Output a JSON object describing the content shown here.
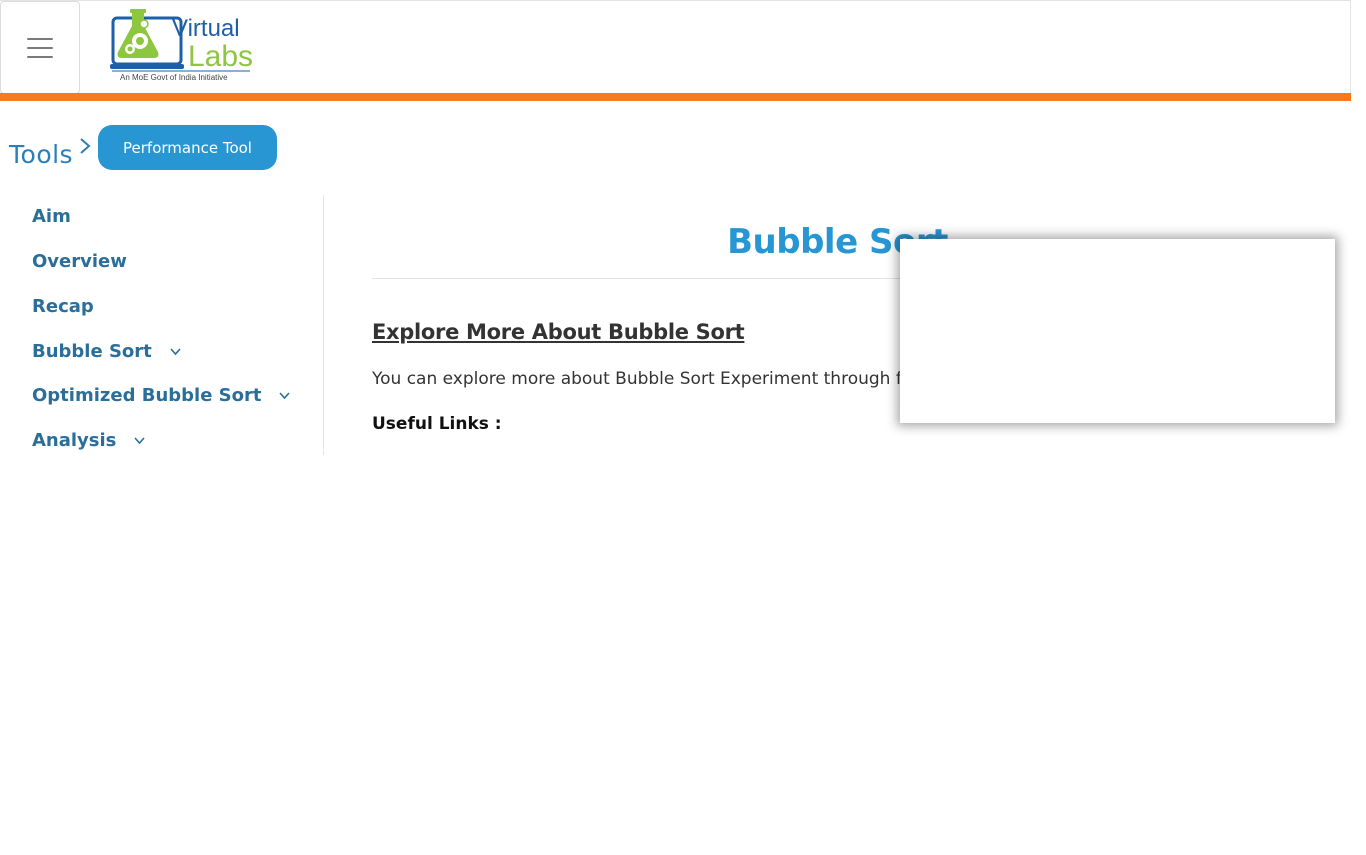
{
  "header": {
    "menu_icon": "hamburger-menu-icon",
    "logo": {
      "text_virtual": "Virtual",
      "text_labs": "Labs",
      "tagline": "An MoE Govt of India Initiative",
      "brand_blue": "#1e5fa8",
      "brand_green": "#8dc63f"
    },
    "accent_bar_color": "#f47b20"
  },
  "breadcrumb": {
    "root": "Tools",
    "separator_icon": "chevron-right-icon",
    "current_button": "Performance Tool"
  },
  "sidebar": {
    "items": [
      {
        "label": "Aim",
        "expandable": false
      },
      {
        "label": "Overview",
        "expandable": false
      },
      {
        "label": "Recap",
        "expandable": false
      },
      {
        "label": "Bubble Sort",
        "expandable": true
      },
      {
        "label": "Optimized Bubble Sort",
        "expandable": true
      },
      {
        "label": "Analysis",
        "expandable": true
      }
    ]
  },
  "main": {
    "title": "Bubble Sort",
    "section_heading": "Explore More About Bubble Sort",
    "paragraph": "You can explore more about Bubble Sort Experiment through following resources:",
    "useful_links_label": "Useful Links :"
  },
  "colors": {
    "accent_blue": "#2896d3",
    "sidebar_text": "#2b6e9a",
    "orange": "#f47b20"
  }
}
